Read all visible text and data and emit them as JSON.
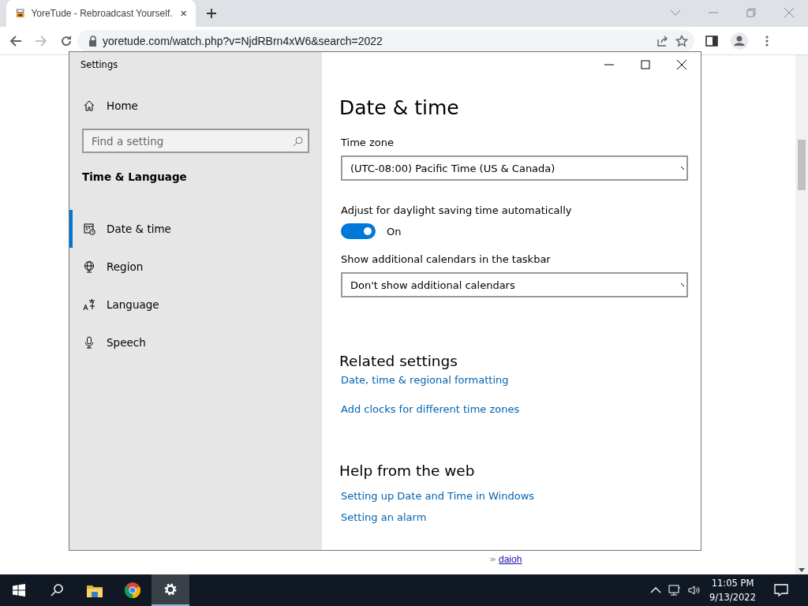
{
  "browser": {
    "tab": {
      "title": "YoreTude - Rebroadcast Yourself."
    },
    "url": "yoretude.com/watch.php?v=NjdRBrn4xW6&search=2022"
  },
  "page": {
    "links": [
      "daioh"
    ]
  },
  "settings": {
    "title": "Settings",
    "home": "Home",
    "search": {
      "placeholder": "Find a setting"
    },
    "section": "Time & Language",
    "nav": [
      {
        "kind": "calendar",
        "label": "Date & time",
        "selected": true
      },
      {
        "kind": "globe",
        "label": "Region",
        "selected": false
      },
      {
        "kind": "language",
        "label": "Language",
        "selected": false
      },
      {
        "kind": "microphone",
        "label": "Speech",
        "selected": false
      }
    ],
    "heading": "Date & time",
    "time_zone": {
      "label": "Time zone",
      "value": "(UTC-08:00) Pacific Time (US & Canada)"
    },
    "dst": {
      "label": "Adjust for daylight saving time automatically",
      "on": true,
      "state_text": "On"
    },
    "calendars": {
      "label": "Show additional calendars in the taskbar",
      "value": "Don't show additional calendars"
    },
    "related": {
      "heading": "Related settings",
      "links": [
        "Date, time & regional formatting",
        "Add clocks for different time zones"
      ]
    },
    "help": {
      "heading": "Help from the web",
      "links": [
        "Setting up Date and Time in Windows",
        "Setting an alarm"
      ]
    }
  },
  "taskbar": {
    "apps": [
      {
        "kind": "search",
        "selected": false
      },
      {
        "kind": "folder",
        "selected": false
      },
      {
        "kind": "chrome",
        "selected": false
      },
      {
        "kind": "settings",
        "selected": true
      }
    ],
    "time": "11:05 PM",
    "date": "9/13/2022"
  }
}
